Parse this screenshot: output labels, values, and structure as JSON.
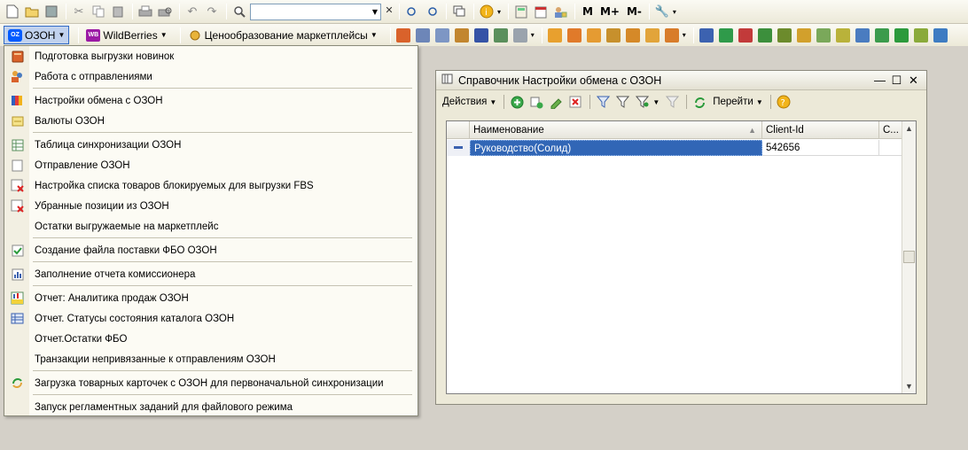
{
  "toolbar": {
    "search_value": "",
    "m_label": "M",
    "mplus_label": "M+",
    "mminus_label": "M-"
  },
  "menubar": {
    "ozon_label": "ОЗОН",
    "wb_label": "WildBerries",
    "wb_badge": "WB",
    "pricing_label": "Ценообразование маркетплейсы"
  },
  "dropdown": {
    "items": [
      {
        "label": "Подготовка выгрузки новинок",
        "icon": "book-icon"
      },
      {
        "label": "Работа с отправлениями",
        "icon": "users-icon"
      },
      {
        "label": "Настройки обмена с ОЗОН",
        "icon": "ozon-icon"
      },
      {
        "label": "Валюты ОЗОН",
        "icon": "currency-icon"
      },
      {
        "label": "Таблица синхронизации ОЗОН",
        "icon": "table-icon"
      },
      {
        "label": "Отправление ОЗОН",
        "icon": "document-icon"
      },
      {
        "label": "Настройка списка товаров блокируемых для выгрузки FBS",
        "icon": "list-x-icon"
      },
      {
        "label": "Убранные позиции из ОЗОН",
        "icon": "list-x-icon"
      },
      {
        "label": "Остатки выгружаемые на маркетплейс",
        "icon": ""
      },
      {
        "label": "Создание файла поставки ФБО ОЗОН",
        "icon": "check-doc-icon"
      },
      {
        "label": "Заполнение отчета комиссионера",
        "icon": "report-icon"
      },
      {
        "label": "Отчет: Аналитика продаж ОЗОН",
        "icon": "abc-report-icon"
      },
      {
        "label": "Отчет. Статусы состояния каталога ОЗОН",
        "icon": "grid-report-icon"
      },
      {
        "label": "Отчет.Остатки ФБО",
        "icon": ""
      },
      {
        "label": "Транзакции непривязанные к отправлениям ОЗОН",
        "icon": ""
      },
      {
        "label": "Загрузка товарных карточек с ОЗОН для первоначальной синхронизации",
        "icon": "sync-icon"
      },
      {
        "label": "Запуск регламентных заданий для файлового режима",
        "icon": ""
      }
    ]
  },
  "window": {
    "title": "Справочник Настройки обмена с ОЗОН",
    "actions_label": "Действия",
    "goto_label": "Перейти",
    "columns": [
      "Наименование",
      "Client-Id",
      "С..."
    ],
    "rows": [
      {
        "name": "Руководство(Солид)",
        "client_id": "542656",
        "extra": ""
      }
    ]
  },
  "colors": {
    "selection": "#3166b6",
    "ozon_brand": "#005bff",
    "wb_brand": "#9b1aa5"
  }
}
